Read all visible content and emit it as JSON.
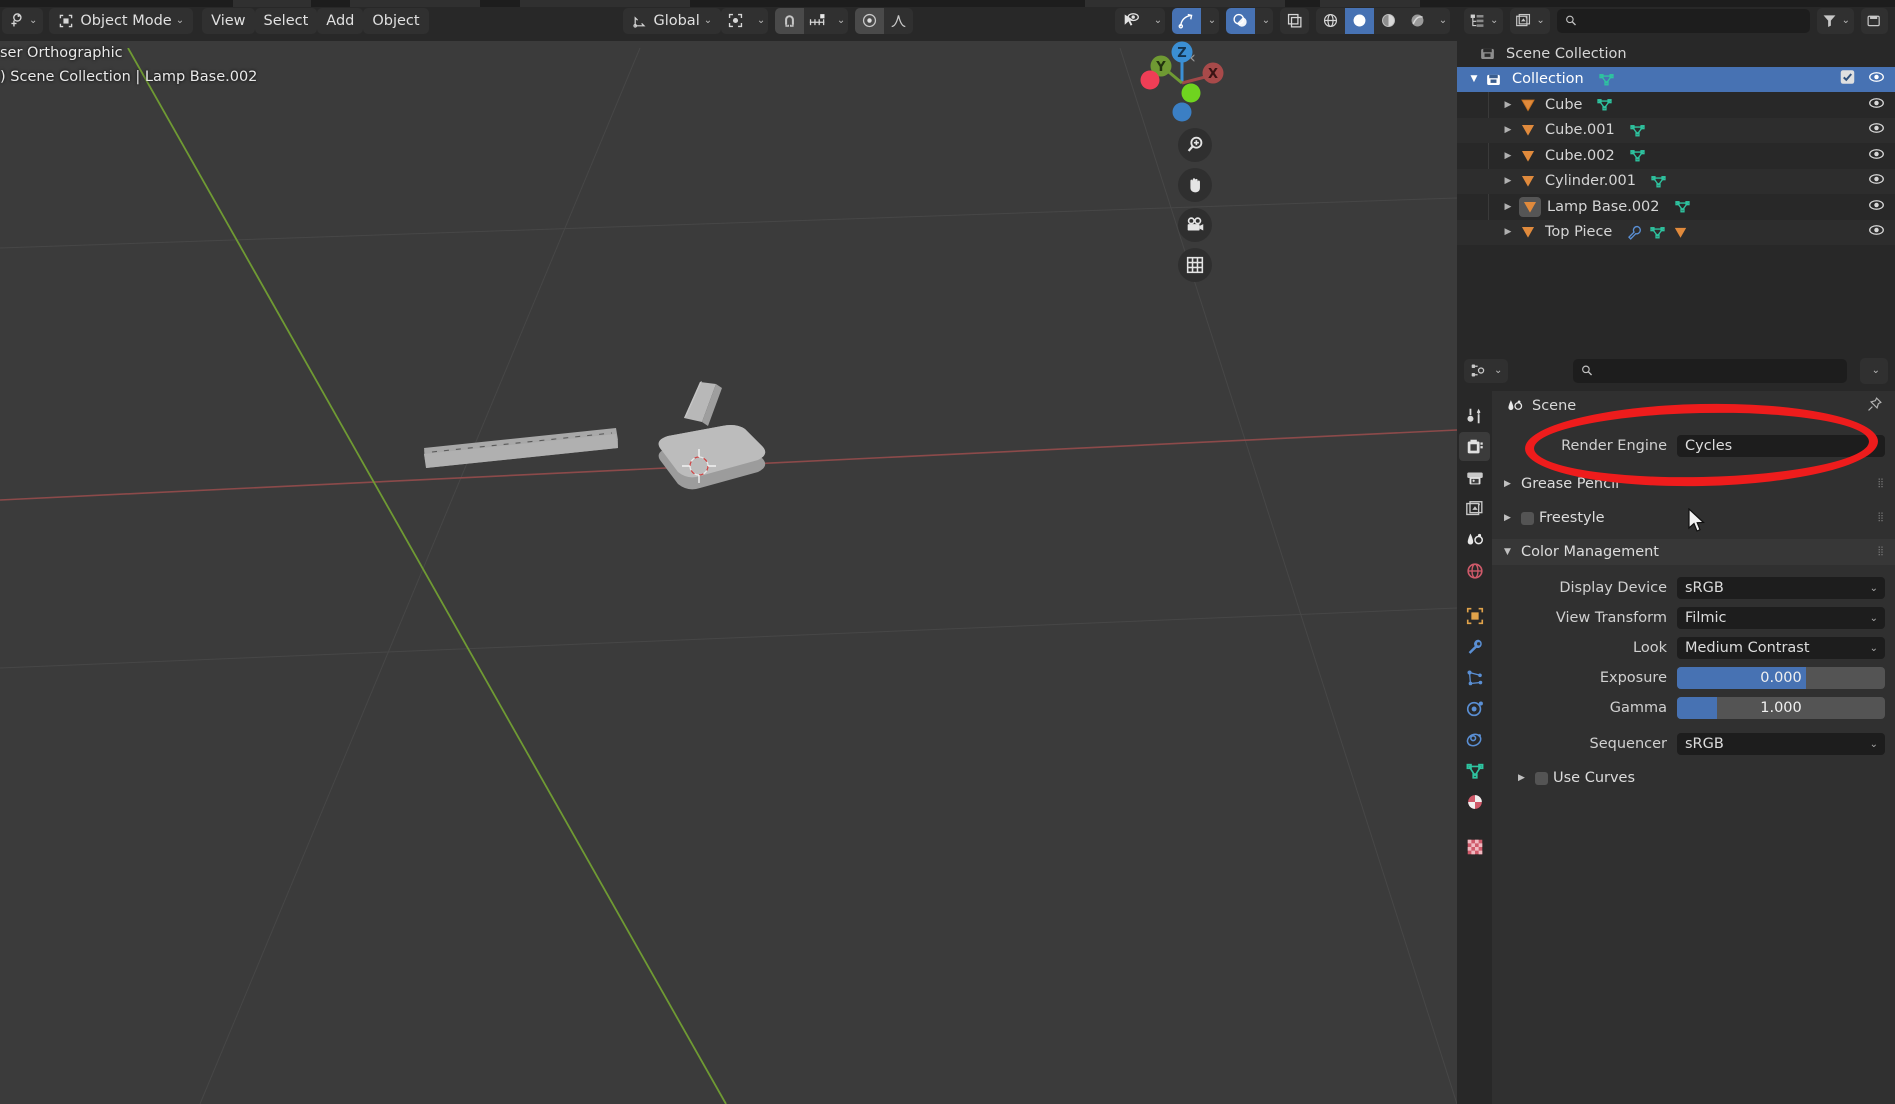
{
  "viewport": {
    "header": {
      "editor_type_icon": "editor-type-icon",
      "mode": "Object Mode",
      "menus": [
        "View",
        "Select",
        "Add",
        "Object"
      ],
      "transform_orientation": "Global",
      "pivot_icon": "pivot-point-icon",
      "snap_magnet_icon": "snap-magnet-icon",
      "snap_target_icon": "snap-increment-icon",
      "proportional_icon": "proportional-edit-icon",
      "proportional_falloff_icon": "falloff-curve-icon",
      "visibility_icon": "object-visibility-icon",
      "gizmo_icon": "gizmo-toggle-icon",
      "overlays_icon": "overlays-toggle-icon",
      "xray_icon": "xray-toggle-icon",
      "shading_wireframe_icon": "shading-wireframe-icon",
      "shading_solid_icon": "shading-solid-icon",
      "shading_material_icon": "shading-material-icon",
      "shading_rendered_icon": "shading-rendered-icon"
    },
    "info_line1": "ser Orthographic",
    "info_line2": ") Scene Collection | Lamp Base.002",
    "gizmo_axes": [
      "Z",
      "Y",
      "X"
    ],
    "nav_buttons": [
      "zoom-icon",
      "pan-hand-icon",
      "camera-icon",
      "grid-ortho-icon"
    ],
    "colors": {
      "bg": "#3b3b3b",
      "axis_x": "#884444",
      "axis_y": "#6a8a3a",
      "grid": "#4a4a4a",
      "gizmo_x": "#c44a4a",
      "gizmo_y": "#7fab3a",
      "gizmo_z": "#3b8fd4"
    }
  },
  "outliner": {
    "header": {
      "display_mode_icon": "outliner-display-mode-icon",
      "filter_id_icon": "filter-id-type-icon",
      "search_placeholder": "",
      "search_value": "",
      "filter_icon": "filter-funnel-icon",
      "new_collection_icon": "new-collection-icon"
    },
    "scene_collection": "Scene Collection",
    "rows": [
      {
        "name": "Collection",
        "icon": "collection-icon",
        "selected": true,
        "indent": 1,
        "disclosure": "down",
        "checkbox": true,
        "visible": true,
        "extra_icons": [
          "mesh-data-icon"
        ]
      },
      {
        "name": "Cube",
        "icon": "mesh-object-icon",
        "selected": false,
        "indent": 2,
        "disclosure": "right",
        "visible": true,
        "extra_icons": [
          "mesh-data-icon"
        ]
      },
      {
        "name": "Cube.001",
        "icon": "mesh-object-icon",
        "selected": false,
        "indent": 2,
        "disclosure": "right",
        "visible": true,
        "extra_icons": [
          "mesh-data-icon"
        ]
      },
      {
        "name": "Cube.002",
        "icon": "mesh-object-icon",
        "selected": false,
        "indent": 2,
        "disclosure": "right",
        "visible": true,
        "extra_icons": [
          "mesh-data-icon"
        ]
      },
      {
        "name": "Cylinder.001",
        "icon": "mesh-object-icon",
        "selected": false,
        "indent": 2,
        "disclosure": "right",
        "visible": true,
        "extra_icons": [
          "mesh-data-icon"
        ]
      },
      {
        "name": "Lamp Base.002",
        "icon": "mesh-object-icon",
        "selected": false,
        "active": true,
        "indent": 2,
        "disclosure": "right",
        "visible": true,
        "extra_icons": [
          "mesh-data-icon"
        ]
      },
      {
        "name": "Top Piece",
        "icon": "mesh-object-icon",
        "selected": false,
        "indent": 2,
        "disclosure": "right",
        "visible": true,
        "extra_icons": [
          "modifier-wrench-icon",
          "mesh-data-icon",
          "mesh-object-icon"
        ]
      }
    ]
  },
  "properties": {
    "header": {
      "editor_type_icon": "properties-editor-icon",
      "search_placeholder": "",
      "search_value": "",
      "options_chevron": "chevron-down-icon"
    },
    "tabs": [
      {
        "name": "tool",
        "icon": "tool-icon",
        "active": false
      },
      {
        "name": "render",
        "icon": "render-camera-icon",
        "active": true
      },
      {
        "name": "output",
        "icon": "output-printer-icon",
        "active": false
      },
      {
        "name": "view-layer",
        "icon": "view-layer-images-icon",
        "active": false
      },
      {
        "name": "scene",
        "icon": "scene-cone-icon",
        "active": false
      },
      {
        "name": "world",
        "icon": "world-globe-icon",
        "active": false
      },
      {
        "name": "object",
        "icon": "object-square-icon",
        "active": false
      },
      {
        "name": "modifiers",
        "icon": "modifier-wrench-icon",
        "active": false
      },
      {
        "name": "particles",
        "icon": "particles-icon",
        "active": false
      },
      {
        "name": "physics",
        "icon": "physics-orbit-icon",
        "active": false
      },
      {
        "name": "constraints",
        "icon": "object-constraints-icon",
        "active": false
      },
      {
        "name": "data",
        "icon": "mesh-data-icon",
        "active": false
      },
      {
        "name": "material",
        "icon": "material-sphere-icon",
        "active": false
      },
      {
        "name": "texture",
        "icon": "texture-checker-icon",
        "active": false
      }
    ],
    "panel_title": "Scene",
    "pin_icon": "pin-icon",
    "render_engine_label": "Render Engine",
    "render_engine_value": "Cycles",
    "sections": [
      {
        "label": "Grease Pencil",
        "expanded": false,
        "checkbox": false
      },
      {
        "label": "Freestyle",
        "expanded": false,
        "checkbox": true,
        "checked": false
      },
      {
        "label": "Color Management",
        "expanded": true,
        "checkbox": false
      }
    ],
    "color_management": {
      "display_device_label": "Display Device",
      "display_device_value": "sRGB",
      "view_transform_label": "View Transform",
      "view_transform_value": "Filmic",
      "look_label": "Look",
      "look_value": "Medium Contrast",
      "exposure_label": "Exposure",
      "exposure_value": "0.000",
      "exposure_fill_pct": 62,
      "gamma_label": "Gamma",
      "gamma_value": "1.000",
      "gamma_fill_pct": 19,
      "sequencer_label": "Sequencer",
      "sequencer_value": "sRGB",
      "use_curves_label": "Use Curves",
      "use_curves_checked": false
    },
    "accent_color": "#4772b3"
  },
  "annotation": {
    "type": "ellipse-highlight",
    "color": "#ee1c1c",
    "target": "Render Engine / Cycles"
  },
  "cursor": {
    "icon": "mouse-pointer-icon"
  }
}
